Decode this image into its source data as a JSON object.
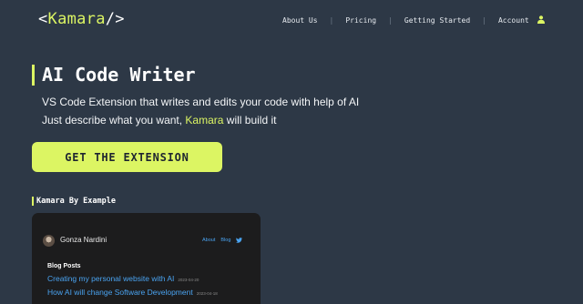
{
  "header": {
    "logo_open": "<",
    "logo_brand": "Kamara",
    "logo_close": "/>",
    "nav": [
      {
        "label": "About Us"
      },
      {
        "label": "Pricing"
      },
      {
        "label": "Getting Started"
      },
      {
        "label": "Account"
      }
    ],
    "separator": "|"
  },
  "hero": {
    "title": "AI Code Writer",
    "line1": "VS Code Extension that writes and edits your code with help of AI",
    "line2_prefix": "Just describe what you want,",
    "line2_brand": "Kamara",
    "line2_suffix": "will build it",
    "cta_label": "GET THE EXTENSION"
  },
  "examples": {
    "section_label": "Kamara By Example",
    "card": {
      "author": "Gonza Nardini",
      "nav": {
        "about": "About",
        "blog": "Blog"
      },
      "posts_heading": "Blog Posts",
      "posts": [
        {
          "title": "Creating my personal website with AI",
          "date": "2023-04-20"
        },
        {
          "title": "How AI will change Software Development",
          "date": "2023-04-18"
        }
      ]
    }
  },
  "colors": {
    "background": "#2d3846",
    "accent": "#dcf563",
    "card_bg": "#1c1c1d",
    "link": "#4aa3f0"
  },
  "icons": {
    "account": "user-icon",
    "twitter": "twitter-icon"
  }
}
